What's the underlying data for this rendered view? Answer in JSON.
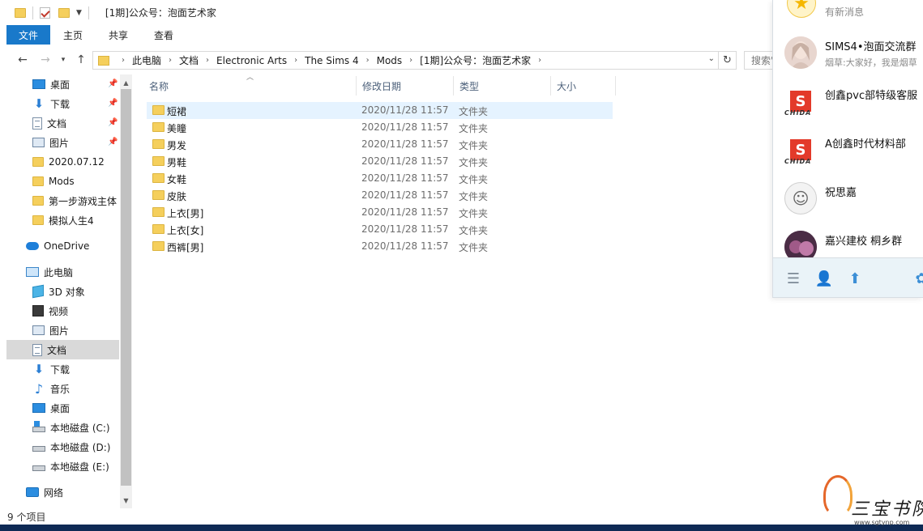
{
  "window": {
    "title": "[1期]公众号：泡面艺术家"
  },
  "ribbon": {
    "tabs": [
      "文件",
      "主页",
      "共享",
      "查看"
    ]
  },
  "address": {
    "crumbs": [
      "此电脑",
      "文档",
      "Electronic Arts",
      "The Sims 4",
      "Mods",
      "[1期]公众号：泡面艺术家"
    ],
    "search_placeholder": "搜索\""
  },
  "sidebar": {
    "quick_access": [
      {
        "label": "桌面",
        "icon": "desktop-icon",
        "pinned": true
      },
      {
        "label": "下载",
        "icon": "download-icon",
        "pinned": true
      },
      {
        "label": "文档",
        "icon": "document-icon",
        "pinned": true
      },
      {
        "label": "图片",
        "icon": "picture-icon",
        "pinned": true
      },
      {
        "label": "2020.07.12",
        "icon": "folder-icon",
        "pinned": false
      },
      {
        "label": "Mods",
        "icon": "folder-icon",
        "pinned": false
      },
      {
        "label": "第一步游戏主体",
        "icon": "folder-icon",
        "pinned": false
      },
      {
        "label": "模拟人生4",
        "icon": "folder-icon",
        "pinned": false
      }
    ],
    "onedrive": "OneDrive",
    "this_pc": "此电脑",
    "pc_items": [
      {
        "label": "3D 对象",
        "icon": "3d-objects-icon"
      },
      {
        "label": "视频",
        "icon": "video-icon"
      },
      {
        "label": "图片",
        "icon": "picture-icon"
      },
      {
        "label": "文档",
        "icon": "document-icon"
      },
      {
        "label": "下载",
        "icon": "download-icon"
      },
      {
        "label": "音乐",
        "icon": "music-icon"
      },
      {
        "label": "桌面",
        "icon": "desktop-icon"
      },
      {
        "label": "本地磁盘 (C:)",
        "icon": "drive-icon"
      },
      {
        "label": "本地磁盘 (D:)",
        "icon": "drive-icon"
      },
      {
        "label": "本地磁盘 (E:)",
        "icon": "drive-icon"
      }
    ],
    "network": "网络",
    "selected": "文档"
  },
  "file_list": {
    "columns": [
      "名称",
      "修改日期",
      "类型",
      "大小"
    ],
    "rows": [
      {
        "name": "短裙",
        "date": "2020/11/28 11:57",
        "type": "文件夹"
      },
      {
        "name": "美瞳",
        "date": "2020/11/28 11:57",
        "type": "文件夹"
      },
      {
        "name": "男发",
        "date": "2020/11/28 11:57",
        "type": "文件夹"
      },
      {
        "name": "男鞋",
        "date": "2020/11/28 11:57",
        "type": "文件夹"
      },
      {
        "name": "女鞋",
        "date": "2020/11/28 11:57",
        "type": "文件夹"
      },
      {
        "name": "皮肤",
        "date": "2020/11/28 11:57",
        "type": "文件夹"
      },
      {
        "name": "上衣[男]",
        "date": "2020/11/28 11:57",
        "type": "文件夹"
      },
      {
        "name": "上衣[女]",
        "date": "2020/11/28 11:57",
        "type": "文件夹"
      },
      {
        "name": "西裤[男]",
        "date": "2020/11/28 11:57",
        "type": "文件夹"
      }
    ]
  },
  "status": {
    "item_count": "9 个项目"
  },
  "qq_panel": {
    "top_subtitle": "有新消息",
    "items": [
      {
        "name": "SIMS4•泡面交流群",
        "message": "烟草:大家好，我是烟草"
      },
      {
        "name": "创鑫pvc部特级客服",
        "message": ""
      },
      {
        "name": "A创鑫时代材料部",
        "message": ""
      },
      {
        "name": "祝思嘉",
        "message": ""
      },
      {
        "name": "嘉兴建校  桐乡群",
        "message": ""
      }
    ],
    "s_logo_text": "CHIDA"
  },
  "watermark": {
    "text": "三宝书院",
    "url": "www.sgtynp.com"
  },
  "colors": {
    "accent": "#1979ca",
    "folder": "#f5cf5c",
    "hover_row": "#e5f3ff",
    "selected_nav": "#d9d9d9"
  }
}
